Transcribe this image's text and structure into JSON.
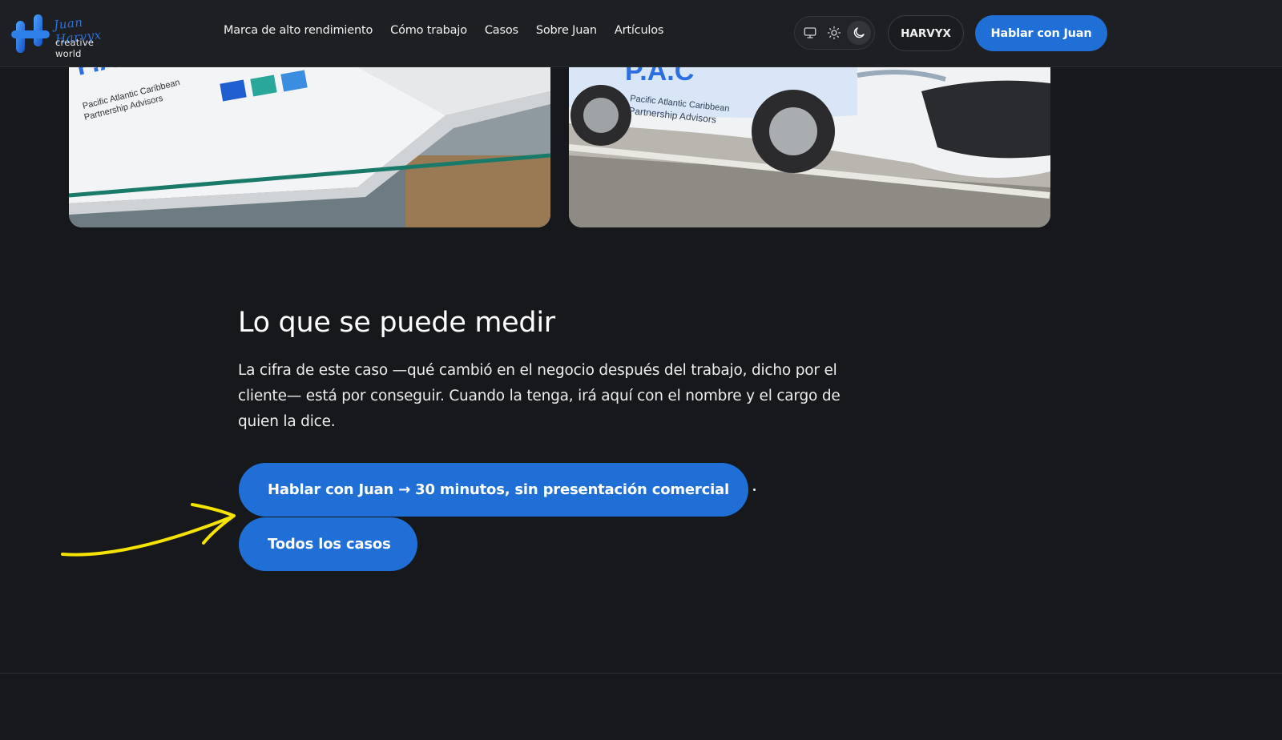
{
  "brand": {
    "signature": "Juan Harvyx",
    "tagline": "creative world",
    "accent": "#1f6fd6"
  },
  "nav": {
    "items": [
      {
        "label": "Marca de alto rendimiento"
      },
      {
        "label": "Cómo trabajo"
      },
      {
        "label": "Casos"
      },
      {
        "label": "Sobre Juan"
      },
      {
        "label": "Artículos"
      }
    ]
  },
  "theme_switch": {
    "options": [
      "monitor-icon",
      "sun-icon",
      "moon-icon"
    ],
    "selected": "moon-icon"
  },
  "header_actions": {
    "brand_button": "HARVYX",
    "cta": "Hablar con Juan"
  },
  "case_images": {
    "left_text": [
      "Pacific Atlantic Caribbean",
      "Partnership Advisors"
    ],
    "right_text": [
      "Pacific Atlantic Caribbean",
      "Partnership Advisors"
    ]
  },
  "section": {
    "title": "Lo que se puede medir",
    "body": "La cifra de este caso —qué cambió en el negocio después del trabajo, dicho por el cliente— está por conseguir. Cuando la tenga, irá aquí con el nombre y el cargo de quien la dice."
  },
  "buttons": {
    "talk": "Hablar con Juan → 30 minutos, sin presentación comercial",
    "all_cases": "Todos los casos"
  },
  "annotation": {
    "arrow_color": "#f5e300"
  }
}
